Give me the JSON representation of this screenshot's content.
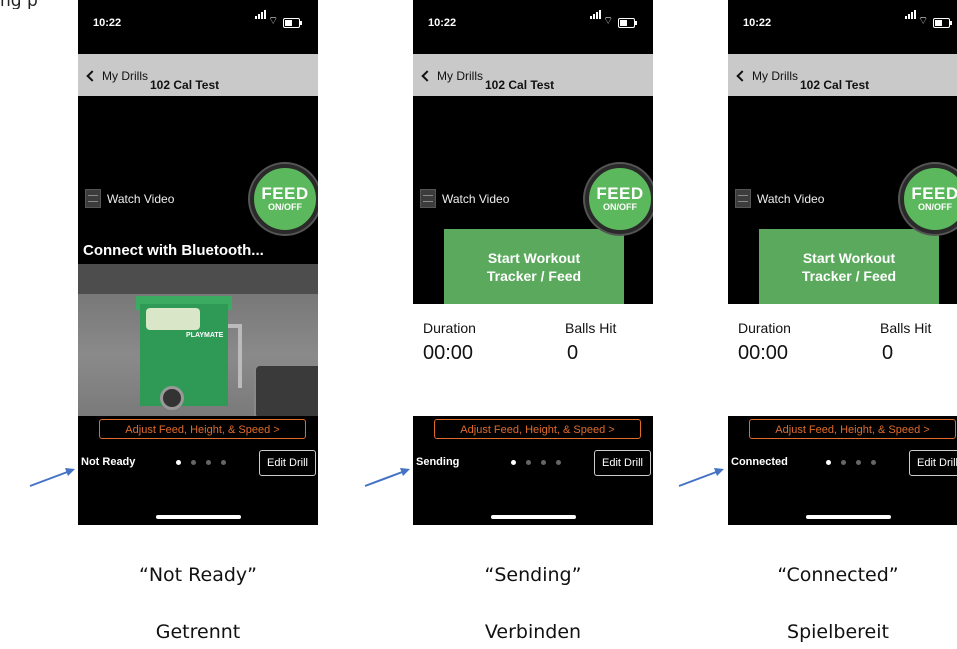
{
  "top_fragment": "ng p",
  "common": {
    "time": "10:22",
    "back_label": "My Drills",
    "drill_title": "102 Cal Test",
    "watch_video": "Watch Video",
    "feed_label": "FEED",
    "feed_sub": "ON/OFF",
    "start_line1": "Start Workout",
    "start_line2": "Tracker / Feed",
    "duration_label": "Duration",
    "balls_label": "Balls Hit",
    "duration_value": "00:00",
    "balls_value": "0",
    "adjust_label": "Adjust Feed, Height, & Speed >",
    "edit_drill": "Edit Drill",
    "connect_text": "Connect with Bluetooth...",
    "cart_logo": "PLAYMATE"
  },
  "screens": [
    {
      "status": "Not Ready",
      "caption_en": "“Not Ready”",
      "caption_de": "Getrennt"
    },
    {
      "status": "Sending",
      "caption_en": "“Sending”",
      "caption_de": "Verbinden"
    },
    {
      "status": "Connected",
      "caption_en": "“Connected”",
      "caption_de": "Spielbereit"
    }
  ],
  "colors": {
    "feed_green": "#5cb85c",
    "start_green": "#5aa95d",
    "adjust_orange": "#e06b2b",
    "arrow_blue": "#4472c4",
    "nav_gray": "#c9c9c9"
  },
  "icons": [
    "chevron-left-icon",
    "film-icon",
    "signal-icon",
    "wifi-icon",
    "battery-icon",
    "arrow-icon"
  ]
}
